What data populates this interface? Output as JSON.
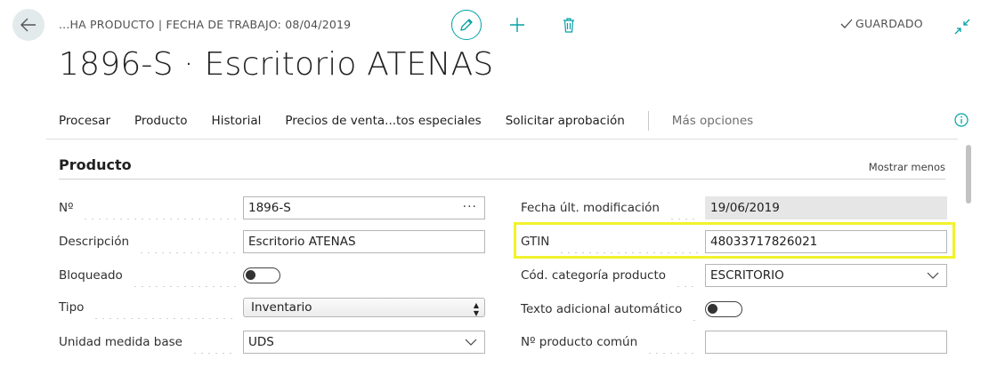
{
  "header": {
    "caption": "...HA PRODUCTO | FECHA DE TRABAJO: 08/04/2019",
    "saved_label": "GUARDADO",
    "title": "1896-S · Escritorio ATENAS"
  },
  "actions": {
    "items": [
      "Procesar",
      "Producto",
      "Historial",
      "Precios de venta...tos especiales",
      "Solicitar aprobación"
    ],
    "more": "Más opciones"
  },
  "section": {
    "title": "Producto",
    "show_less": "Mostrar menos"
  },
  "fields_left": [
    {
      "label": "Nº",
      "value": "1896-S"
    },
    {
      "label": "Descripción",
      "value": "Escritorio ATENAS"
    },
    {
      "label": "Bloqueado",
      "value": "off"
    },
    {
      "label": "Tipo",
      "value": "Inventario"
    },
    {
      "label": "Unidad medida base",
      "value": "UDS"
    }
  ],
  "fields_right": [
    {
      "label": "Fecha últ. modificación",
      "value": "19/06/2019"
    },
    {
      "label": "GTIN",
      "value": "48033717826021"
    },
    {
      "label": "Cód. categoría producto",
      "value": "ESCRITORIO"
    },
    {
      "label": "Texto adicional automático",
      "value": "off"
    },
    {
      "label": "Nº producto común",
      "value": ""
    }
  ],
  "colors": {
    "accent": "#00a1a6",
    "highlight": "#f2f22a",
    "readonly_bg": "#e6e6e6"
  },
  "icons": [
    "arrow-left-icon",
    "pencil-icon",
    "plus-icon",
    "trash-icon",
    "check-icon",
    "collapse-icon",
    "info-icon",
    "chevron-down-icon",
    "ellipsis-icon",
    "updown-icon"
  ]
}
